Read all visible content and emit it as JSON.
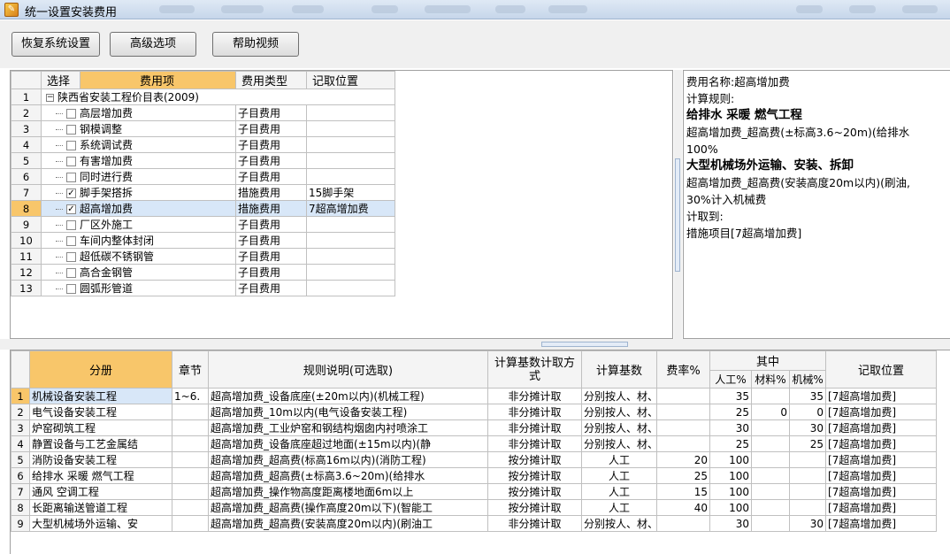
{
  "window": {
    "title": "统一设置安装费用",
    "icon": "app-icon"
  },
  "toolbar": {
    "restore_label": "恢复系统设置",
    "advanced_label": "高级选项",
    "help_label": "帮助视频"
  },
  "tree": {
    "headers": {
      "select": "选择",
      "item": "费用项",
      "type": "费用类型",
      "pos": "记取位置"
    },
    "root": {
      "row": "1",
      "label": "陕西省安装工程价目表(2009)"
    },
    "rows": [
      {
        "row": "2",
        "checked": false,
        "label": "高层增加费",
        "type": "子目费用",
        "pos": ""
      },
      {
        "row": "3",
        "checked": false,
        "label": "钢模调整",
        "type": "子目费用",
        "pos": ""
      },
      {
        "row": "4",
        "checked": false,
        "label": "系统调试费",
        "type": "子目费用",
        "pos": ""
      },
      {
        "row": "5",
        "checked": false,
        "label": "有害增加费",
        "type": "子目费用",
        "pos": ""
      },
      {
        "row": "6",
        "checked": false,
        "label": "同时进行费",
        "type": "子目费用",
        "pos": ""
      },
      {
        "row": "7",
        "checked": true,
        "label": "脚手架搭拆",
        "type": "措施费用",
        "pos": "15脚手架"
      },
      {
        "row": "8",
        "checked": true,
        "label": "超高增加费",
        "type": "措施费用",
        "pos": "7超高增加费"
      },
      {
        "row": "9",
        "checked": false,
        "label": "厂区外施工",
        "type": "子目费用",
        "pos": ""
      },
      {
        "row": "10",
        "checked": false,
        "label": "车间内整体封闭",
        "type": "子目费用",
        "pos": ""
      },
      {
        "row": "11",
        "checked": false,
        "label": "超低碳不锈钢管",
        "type": "子目费用",
        "pos": ""
      },
      {
        "row": "12",
        "checked": false,
        "label": "高合金钢管",
        "type": "子目费用",
        "pos": ""
      },
      {
        "row": "13",
        "checked": false,
        "label": "圆弧形管道",
        "type": "子目费用",
        "pos": ""
      }
    ],
    "selected_row": "8"
  },
  "info": {
    "lines": [
      {
        "text": "费用名称:超高增加费",
        "bold": false
      },
      {
        "text": "计算规则:",
        "bold": false
      },
      {
        "text": "给排水 采暖 燃气工程",
        "bold": true
      },
      {
        "text": "超高增加费_超高费(±标高3.6~20m)(给排水",
        "bold": false
      },
      {
        "text": "100%",
        "bold": false
      },
      {
        "text": "大型机械场外运输、安装、拆卸",
        "bold": true
      },
      {
        "text": "超高增加费_超高费(安装高度20m以内)(刷油,",
        "bold": false
      },
      {
        "text": "30%计入机械费",
        "bold": false
      },
      {
        "text": "计取到:",
        "bold": false
      },
      {
        "text": "措施项目[7超高增加费]",
        "bold": false
      }
    ]
  },
  "grid": {
    "headers": {
      "division": "分册",
      "chapter": "章节",
      "rule": "规则说明(可选取)",
      "method": "计算基数计取方式",
      "base": "计算基数",
      "rate": "费率%",
      "group": "其中",
      "labor": "人工%",
      "material": "材料%",
      "machine": "机械%",
      "pos": "记取位置"
    },
    "rows": [
      {
        "row": "1",
        "division": "机械设备安装工程",
        "chapter": "1~6.",
        "rule": "超高增加费_设备底座(±20m以内)(机械工程)",
        "method": "非分摊计取",
        "base": "分别按人、材、机取",
        "rate": "",
        "labor": "35",
        "material": "",
        "machine": "35",
        "pos": "[7超高增加费]"
      },
      {
        "row": "2",
        "division": "电气设备安装工程",
        "chapter": "",
        "rule": "超高增加费_10m以内(电气设备安装工程)",
        "method": "非分摊计取",
        "base": "分别按人、材、机取",
        "rate": "",
        "labor": "25",
        "material": "0",
        "machine": "0",
        "pos": "[7超高增加费]"
      },
      {
        "row": "3",
        "division": "炉窑砌筑工程",
        "chapter": "",
        "rule": "超高增加费_工业炉窑和钢结构烟囱内衬喷涂工",
        "method": "非分摊计取",
        "base": "分别按人、材、机取",
        "rate": "",
        "labor": "30",
        "material": "",
        "machine": "30",
        "pos": "[7超高增加费]"
      },
      {
        "row": "4",
        "division": "静置设备与工艺金属结",
        "chapter": "",
        "rule": "超高增加费_设备底座超过地面(±15m以内)(静",
        "method": "非分摊计取",
        "base": "分别按人、材、机取",
        "rate": "",
        "labor": "25",
        "material": "",
        "machine": "25",
        "pos": "[7超高增加费]"
      },
      {
        "row": "5",
        "division": "消防设备安装工程",
        "chapter": "",
        "rule": "超高增加费_超高费(标高16m以内)(消防工程)",
        "method": "按分摊计取",
        "base": "人工",
        "rate": "20",
        "labor": "100",
        "material": "",
        "machine": "",
        "pos": "[7超高增加费]"
      },
      {
        "row": "6",
        "division": "给排水 采暖 燃气工程",
        "chapter": "",
        "rule": "超高增加费_超高费(±标高3.6~20m)(给排水",
        "method": "按分摊计取",
        "base": "人工",
        "rate": "25",
        "labor": "100",
        "material": "",
        "machine": "",
        "pos": "[7超高增加费]"
      },
      {
        "row": "7",
        "division": "通风 空调工程",
        "chapter": "",
        "rule": "超高增加费_操作物高度距离楼地面6m以上",
        "method": "按分摊计取",
        "base": "人工",
        "rate": "15",
        "labor": "100",
        "material": "",
        "machine": "",
        "pos": "[7超高增加费]"
      },
      {
        "row": "8",
        "division": "长距离输送管道工程",
        "chapter": "",
        "rule": "超高增加费_超高费(操作高度20m以下)(智能工",
        "method": "按分摊计取",
        "base": "人工",
        "rate": "40",
        "labor": "100",
        "material": "",
        "machine": "",
        "pos": "[7超高增加费]"
      },
      {
        "row": "9",
        "division": "大型机械场外运输、安",
        "chapter": "",
        "rule": "超高增加费_超高费(安装高度20m以内)(刷油工",
        "method": "非分摊计取",
        "base": "分别按人、材、机取",
        "rate": "",
        "labor": "30",
        "material": "",
        "machine": "30",
        "pos": "[7超高增加费]"
      }
    ],
    "selected_row": "1"
  }
}
